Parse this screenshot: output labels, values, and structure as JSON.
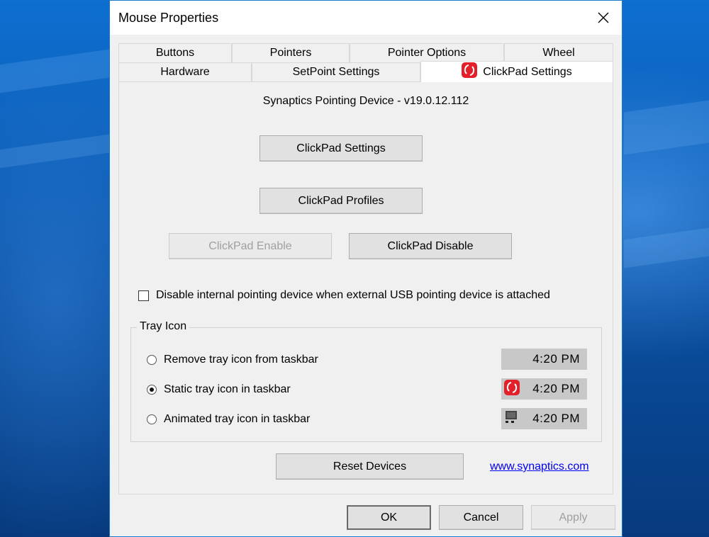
{
  "window": {
    "title": "Mouse Properties"
  },
  "tabs": {
    "row1": [
      "Buttons",
      "Pointers",
      "Pointer Options",
      "Wheel"
    ],
    "row2": [
      "Hardware",
      "SetPoint Settings",
      "ClickPad Settings"
    ],
    "active": "ClickPad Settings"
  },
  "panel": {
    "device_label": "Synaptics Pointing Device - v19.0.12.112",
    "clickpad_settings_label": "ClickPad Settings",
    "clickpad_profiles_label": "ClickPad Profiles",
    "clickpad_enable_label": "ClickPad Enable",
    "clickpad_disable_label": "ClickPad Disable",
    "disable_internal_label": "Disable internal pointing device when external USB pointing device is attached",
    "disable_internal_checked": false,
    "tray_group_label": "Tray Icon",
    "tray_options": [
      {
        "label": "Remove tray icon from taskbar",
        "checked": false,
        "preview_time": "4:20 PM",
        "preview_icon": "none"
      },
      {
        "label": "Static tray icon in taskbar",
        "checked": true,
        "preview_time": "4:20 PM",
        "preview_icon": "synaptics-icon"
      },
      {
        "label": "Animated tray icon in taskbar",
        "checked": false,
        "preview_time": "4:20 PM",
        "preview_icon": "monitor-icon"
      }
    ],
    "reset_devices_label": "Reset Devices",
    "link_text": "www.synaptics.com"
  },
  "footer": {
    "ok_label": "OK",
    "cancel_label": "Cancel",
    "apply_label": "Apply"
  },
  "colors": {
    "accent": "#1979ca",
    "synaptics_red": "#e3202a",
    "link": "#0000ee"
  }
}
